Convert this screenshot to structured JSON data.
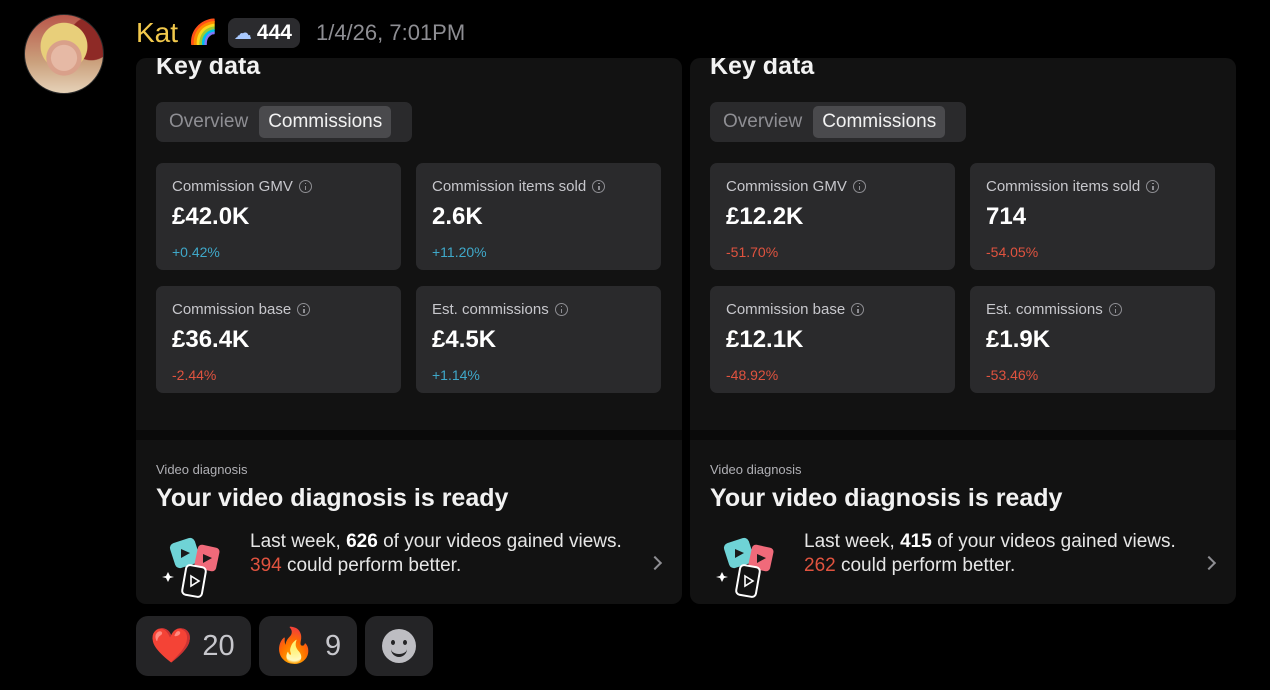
{
  "message": {
    "username": "Kat",
    "username_emoji": "🌈",
    "badge_icon": "cloud-icon",
    "badge_count": "444",
    "timestamp": "1/4/26, 7:01PM"
  },
  "panels": [
    {
      "title": "Key data",
      "tabs": [
        "Overview",
        "Commissions"
      ],
      "active_tab": "Commissions",
      "cards": [
        {
          "label": "Commission GMV",
          "value": "£42.0K",
          "change": "+0.42%",
          "trend": "pos"
        },
        {
          "label": "Commission items sold",
          "value": "2.6K",
          "change": "+11.20%",
          "trend": "pos"
        },
        {
          "label": "Commission base",
          "value": "£36.4K",
          "change": "-2.44%",
          "trend": "neg"
        },
        {
          "label": "Est. commissions",
          "value": "£4.5K",
          "change": "+1.14%",
          "trend": "pos"
        }
      ],
      "diagnosis": {
        "label": "Video diagnosis",
        "title": "Your video diagnosis is ready",
        "text_1": "Last week, ",
        "videos_count": "626",
        "text_2": " of your videos gained views. ",
        "could_count": "394",
        "text_3": " could perform better."
      }
    },
    {
      "title": "Key data",
      "tabs": [
        "Overview",
        "Commissions"
      ],
      "active_tab": "Commissions",
      "cards": [
        {
          "label": "Commission GMV",
          "value": "£12.2K",
          "change": "-51.70%",
          "trend": "neg"
        },
        {
          "label": "Commission items sold",
          "value": "714",
          "change": "-54.05%",
          "trend": "neg"
        },
        {
          "label": "Commission base",
          "value": "£12.1K",
          "change": "-48.92%",
          "trend": "neg"
        },
        {
          "label": "Est. commissions",
          "value": "£1.9K",
          "change": "-53.46%",
          "trend": "neg"
        }
      ],
      "diagnosis": {
        "label": "Video diagnosis",
        "title": "Your video diagnosis is ready",
        "text_1": "Last week, ",
        "videos_count": "415",
        "text_2": " of your videos gained views. ",
        "could_count": "262",
        "text_3": " could perform better."
      }
    }
  ],
  "reactions": [
    {
      "emoji": "❤️",
      "icon": "heart-icon",
      "count": "20"
    },
    {
      "emoji": "🔥",
      "icon": "fire-icon",
      "count": "9"
    }
  ],
  "colors": {
    "username": "#f2c94c",
    "positive": "#3fa8c9",
    "negative": "#e0533f"
  }
}
